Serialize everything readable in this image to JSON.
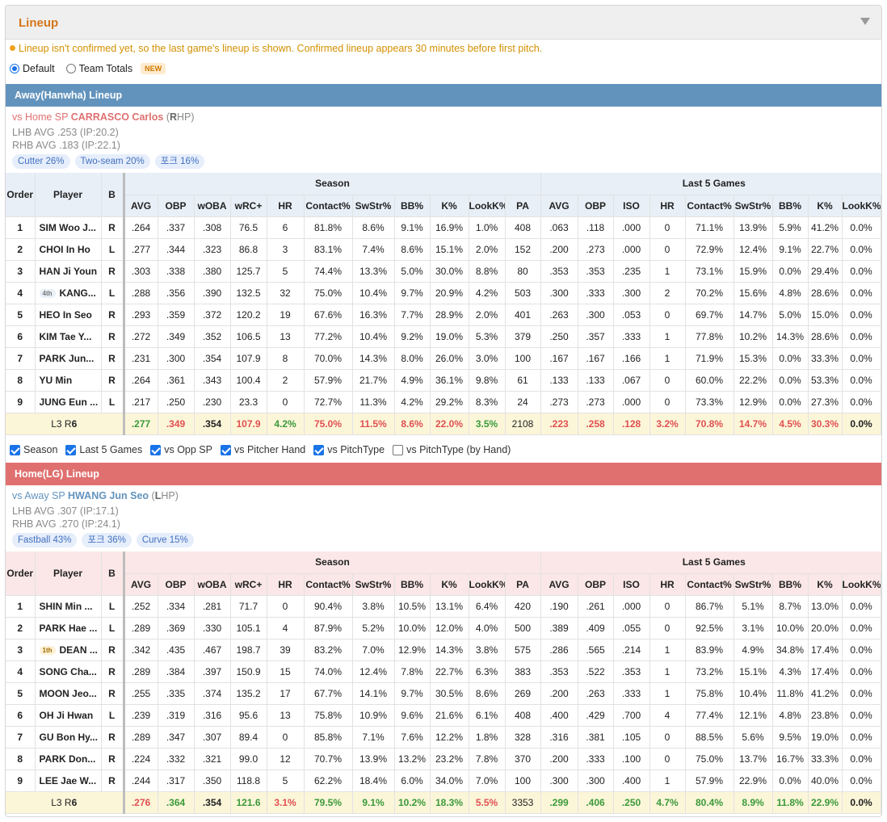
{
  "panel": {
    "title": "Lineup"
  },
  "notice": "Lineup isn't confirmed yet, so the last game's lineup is shown. Confirmed lineup appears 30 minutes before first pitch.",
  "view_options": {
    "default_label": "Default",
    "team_totals_label": "Team Totals",
    "new_badge": "NEW",
    "selected": "Default"
  },
  "columns": {
    "order": "Order",
    "player": "Player",
    "bats": "B",
    "season_group": "Season",
    "last5_group": "Last 5 Games",
    "season": [
      "AVG",
      "OBP",
      "wOBA",
      "wRC+",
      "HR",
      "Contact%",
      "SwStr%",
      "BB%",
      "K%",
      "LookK%",
      "PA"
    ],
    "last5": [
      "AVG",
      "OBP",
      "ISO",
      "HR",
      "Contact%",
      "SwStr%",
      "BB%",
      "K%",
      "LookK%"
    ]
  },
  "away": {
    "header": "Away(Hanwha) Lineup",
    "sp_prefix": "vs Home SP",
    "sp_name": "CARRASCO Carlos",
    "sp_open": "(",
    "sp_hand_bold": "R",
    "sp_hand_rest": "HP)",
    "lhb": "LHB AVG .253 (IP:20.2)",
    "rhb": "RHB AVG .183 (IP:22.1)",
    "pitches": [
      "Cutter 26%",
      "Two-seam 20%",
      "포크 16%"
    ],
    "rows": [
      {
        "order": "1",
        "badge": "",
        "player": "SIM Woo J...",
        "bats": "R",
        "season": [
          ".264",
          ".337",
          ".308",
          "76.5",
          "6",
          "81.8%",
          "8.6%",
          "9.1%",
          "16.9%",
          "1.0%",
          "408"
        ],
        "last5": [
          ".063",
          ".118",
          ".000",
          "0",
          "71.1%",
          "13.9%",
          "5.9%",
          "41.2%",
          "0.0%"
        ]
      },
      {
        "order": "2",
        "badge": "",
        "player": "CHOI In Ho",
        "bats": "L",
        "season": [
          ".277",
          ".344",
          ".323",
          "86.8",
          "3",
          "83.1%",
          "7.4%",
          "8.6%",
          "15.1%",
          "2.0%",
          "152"
        ],
        "last5": [
          ".200",
          ".273",
          ".000",
          "0",
          "72.9%",
          "12.4%",
          "9.1%",
          "22.7%",
          "0.0%"
        ]
      },
      {
        "order": "3",
        "badge": "",
        "player": "HAN Ji Youn",
        "bats": "R",
        "season": [
          ".303",
          ".338",
          ".380",
          "125.7",
          "5",
          "74.4%",
          "13.3%",
          "5.0%",
          "30.0%",
          "8.8%",
          "80"
        ],
        "last5": [
          ".353",
          ".353",
          ".235",
          "1",
          "73.1%",
          "15.9%",
          "0.0%",
          "29.4%",
          "0.0%"
        ]
      },
      {
        "order": "4",
        "badge": "4th",
        "player": "KANG...",
        "bats": "L",
        "season": [
          ".288",
          ".356",
          ".390",
          "132.5",
          "32",
          "75.0%",
          "10.4%",
          "9.7%",
          "20.9%",
          "4.2%",
          "503"
        ],
        "last5": [
          ".300",
          ".333",
          ".300",
          "2",
          "70.2%",
          "15.6%",
          "4.8%",
          "28.6%",
          "0.0%"
        ]
      },
      {
        "order": "5",
        "badge": "",
        "player": "HEO In Seo",
        "bats": "R",
        "season": [
          ".293",
          ".359",
          ".372",
          "120.2",
          "19",
          "67.6%",
          "16.3%",
          "7.7%",
          "28.9%",
          "2.0%",
          "401"
        ],
        "last5": [
          ".263",
          ".300",
          ".053",
          "0",
          "69.7%",
          "14.7%",
          "5.0%",
          "15.0%",
          "0.0%"
        ]
      },
      {
        "order": "6",
        "badge": "",
        "player": "KIM Tae Y...",
        "bats": "R",
        "season": [
          ".272",
          ".349",
          ".352",
          "106.5",
          "13",
          "77.2%",
          "10.4%",
          "9.2%",
          "19.0%",
          "5.3%",
          "379"
        ],
        "last5": [
          ".250",
          ".357",
          ".333",
          "1",
          "77.8%",
          "10.2%",
          "14.3%",
          "28.6%",
          "0.0%"
        ]
      },
      {
        "order": "7",
        "badge": "",
        "player": "PARK Jun...",
        "bats": "R",
        "season": [
          ".231",
          ".300",
          ".354",
          "107.9",
          "8",
          "70.0%",
          "14.3%",
          "8.0%",
          "26.0%",
          "3.0%",
          "100"
        ],
        "last5": [
          ".167",
          ".167",
          ".166",
          "1",
          "71.9%",
          "15.3%",
          "0.0%",
          "33.3%",
          "0.0%"
        ]
      },
      {
        "order": "8",
        "badge": "",
        "player": "YU Min",
        "bats": "R",
        "season": [
          ".264",
          ".361",
          ".343",
          "100.4",
          "2",
          "57.9%",
          "21.7%",
          "4.9%",
          "36.1%",
          "9.8%",
          "61"
        ],
        "last5": [
          ".133",
          ".133",
          ".067",
          "0",
          "60.0%",
          "22.2%",
          "0.0%",
          "53.3%",
          "0.0%"
        ]
      },
      {
        "order": "9",
        "badge": "",
        "player": "JUNG Eun ...",
        "bats": "L",
        "season": [
          ".217",
          ".250",
          ".230",
          "23.3",
          "0",
          "72.7%",
          "11.3%",
          "4.2%",
          "29.2%",
          "8.3%",
          "24"
        ],
        "last5": [
          ".273",
          ".273",
          ".000",
          "0",
          "73.3%",
          "12.9%",
          "0.0%",
          "27.3%",
          "0.0%"
        ]
      }
    ],
    "total": {
      "label_prefix": "L3 R",
      "label_num": "6",
      "season": [
        ".277",
        ".349",
        ".354",
        "107.9",
        "4.2%",
        "75.0%",
        "11.5%",
        "8.6%",
        "22.0%",
        "3.5%",
        "2108"
      ],
      "season_colors": [
        "g",
        "r",
        "k",
        "r",
        "g",
        "r",
        "r",
        "r",
        "r",
        "g",
        "n"
      ],
      "last5": [
        ".223",
        ".258",
        ".128",
        "3.2%",
        "70.8%",
        "14.7%",
        "4.5%",
        "30.3%",
        "0.0%"
      ],
      "last5_colors": [
        "r",
        "r",
        "r",
        "r",
        "r",
        "r",
        "r",
        "r",
        "k"
      ]
    }
  },
  "toggles": [
    {
      "label": "Season",
      "checked": true
    },
    {
      "label": "Last 5 Games",
      "checked": true
    },
    {
      "label": "vs Opp SP",
      "checked": true
    },
    {
      "label": "vs Pitcher Hand",
      "checked": true
    },
    {
      "label": "vs PitchType",
      "checked": true
    },
    {
      "label": "vs PitchType (by Hand)",
      "checked": false
    }
  ],
  "home": {
    "header": "Home(LG) Lineup",
    "sp_prefix": "vs Away SP",
    "sp_name": "HWANG Jun Seo",
    "sp_open": "(",
    "sp_hand_bold": "L",
    "sp_hand_rest": "HP)",
    "lhb": "LHB AVG .307 (IP:17.1)",
    "rhb": "RHB AVG .270 (IP:24.1)",
    "pitches": [
      "Fastball 43%",
      "포크 36%",
      "Curve 15%"
    ],
    "rows": [
      {
        "order": "1",
        "badge": "",
        "player": "SHIN Min ...",
        "bats": "L",
        "season": [
          ".252",
          ".334",
          ".281",
          "71.7",
          "0",
          "90.4%",
          "3.8%",
          "10.5%",
          "13.1%",
          "6.4%",
          "420"
        ],
        "last5": [
          ".190",
          ".261",
          ".000",
          "0",
          "86.7%",
          "5.1%",
          "8.7%",
          "13.0%",
          "0.0%"
        ]
      },
      {
        "order": "2",
        "badge": "",
        "player": "PARK Hae ...",
        "bats": "L",
        "season": [
          ".289",
          ".369",
          ".330",
          "105.1",
          "4",
          "87.9%",
          "5.2%",
          "10.0%",
          "12.0%",
          "4.0%",
          "500"
        ],
        "last5": [
          ".389",
          ".409",
          ".055",
          "0",
          "92.5%",
          "3.1%",
          "10.0%",
          "20.0%",
          "0.0%"
        ]
      },
      {
        "order": "3",
        "badge": "1th",
        "player": "DEAN ...",
        "bats": "R",
        "season": [
          ".342",
          ".435",
          ".467",
          "198.7",
          "39",
          "83.2%",
          "7.0%",
          "12.9%",
          "14.3%",
          "3.8%",
          "575"
        ],
        "last5": [
          ".286",
          ".565",
          ".214",
          "1",
          "83.9%",
          "4.9%",
          "34.8%",
          "17.4%",
          "0.0%"
        ]
      },
      {
        "order": "4",
        "badge": "",
        "player": "SONG Cha...",
        "bats": "R",
        "season": [
          ".289",
          ".384",
          ".397",
          "150.9",
          "15",
          "74.0%",
          "12.4%",
          "7.8%",
          "22.7%",
          "6.3%",
          "383"
        ],
        "last5": [
          ".353",
          ".522",
          ".353",
          "1",
          "73.2%",
          "15.1%",
          "4.3%",
          "17.4%",
          "0.0%"
        ]
      },
      {
        "order": "5",
        "badge": "",
        "player": "MOON Jeo...",
        "bats": "R",
        "season": [
          ".255",
          ".335",
          ".374",
          "135.2",
          "17",
          "67.7%",
          "14.1%",
          "9.7%",
          "30.5%",
          "8.6%",
          "269"
        ],
        "last5": [
          ".200",
          ".263",
          ".333",
          "1",
          "75.8%",
          "10.4%",
          "11.8%",
          "41.2%",
          "0.0%"
        ]
      },
      {
        "order": "6",
        "badge": "",
        "player": "OH Ji Hwan",
        "bats": "L",
        "season": [
          ".239",
          ".319",
          ".316",
          "95.6",
          "13",
          "75.8%",
          "10.9%",
          "9.6%",
          "21.6%",
          "6.1%",
          "408"
        ],
        "last5": [
          ".400",
          ".429",
          ".700",
          "4",
          "77.4%",
          "12.1%",
          "4.8%",
          "23.8%",
          "0.0%"
        ]
      },
      {
        "order": "7",
        "badge": "",
        "player": "GU Bon Hy...",
        "bats": "R",
        "season": [
          ".289",
          ".347",
          ".307",
          "89.4",
          "0",
          "85.8%",
          "7.1%",
          "7.6%",
          "12.2%",
          "1.8%",
          "328"
        ],
        "last5": [
          ".316",
          ".381",
          ".105",
          "0",
          "88.5%",
          "5.6%",
          "9.5%",
          "19.0%",
          "0.0%"
        ]
      },
      {
        "order": "8",
        "badge": "",
        "player": "PARK Don...",
        "bats": "R",
        "season": [
          ".224",
          ".332",
          ".321",
          "99.0",
          "12",
          "70.7%",
          "13.9%",
          "13.2%",
          "23.2%",
          "7.8%",
          "370"
        ],
        "last5": [
          ".200",
          ".333",
          ".100",
          "0",
          "75.0%",
          "13.7%",
          "16.7%",
          "33.3%",
          "0.0%"
        ]
      },
      {
        "order": "9",
        "badge": "",
        "player": "LEE Jae W...",
        "bats": "R",
        "season": [
          ".244",
          ".317",
          ".350",
          "118.8",
          "5",
          "62.2%",
          "18.4%",
          "6.0%",
          "34.0%",
          "7.0%",
          "100"
        ],
        "last5": [
          ".300",
          ".300",
          ".400",
          "1",
          "57.9%",
          "22.9%",
          "0.0%",
          "40.0%",
          "0.0%"
        ]
      }
    ],
    "total": {
      "label_prefix": "L3 R",
      "label_num": "6",
      "season": [
        ".276",
        ".364",
        ".354",
        "121.6",
        "3.1%",
        "79.5%",
        "9.1%",
        "10.2%",
        "18.3%",
        "5.5%",
        "3353"
      ],
      "season_colors": [
        "r",
        "g",
        "k",
        "g",
        "r",
        "g",
        "g",
        "g",
        "g",
        "r",
        "n"
      ],
      "last5": [
        ".299",
        ".406",
        ".250",
        "4.7%",
        "80.4%",
        "8.9%",
        "11.8%",
        "22.9%",
        "0.0%"
      ],
      "last5_colors": [
        "g",
        "g",
        "g",
        "g",
        "g",
        "g",
        "g",
        "g",
        "k"
      ]
    }
  },
  "colors": {
    "away_header": "#6293bd",
    "home_header": "#e07070",
    "title": "#d4761a",
    "good": "#3a9a3a",
    "bad": "#e05050",
    "total_bg": "#fcf6d9"
  }
}
